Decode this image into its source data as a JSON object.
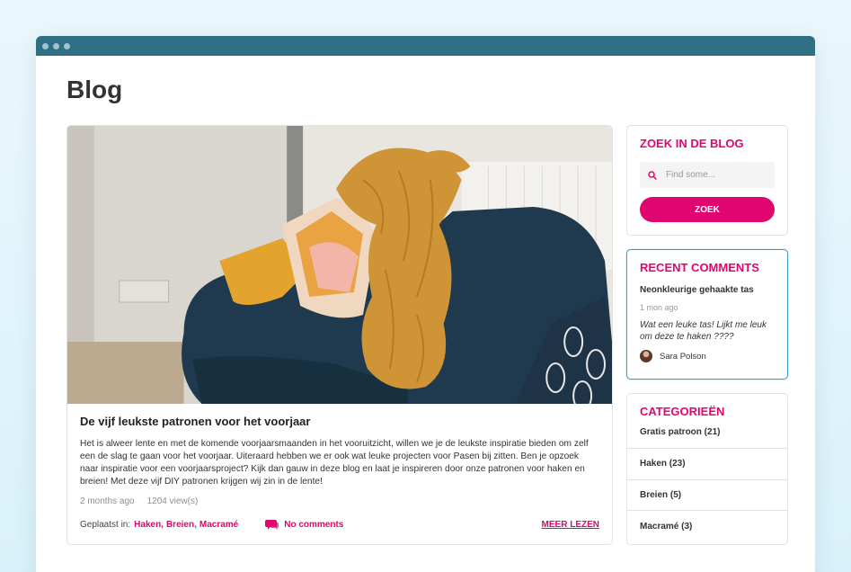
{
  "page": {
    "title": "Blog"
  },
  "post": {
    "title": "De vijf leukste patronen voor het voorjaar",
    "excerpt": "Het is alweer lente en met de komende voorjaarsmaanden in het vooruitzicht, willen we je de leukste inspiratie bieden om zelf een de slag te gaan voor het voorjaar. Uiteraard hebben we er ook wat leuke projecten voor Pasen bij zitten. Ben je opzoek naar inspiratie voor een voorjaarsproject? Kijk dan gauw in deze blog en laat je inspireren door onze patronen voor haken en breien! Met deze vijf DIY patronen krijgen wij zin in de lente!",
    "time": "2 months ago",
    "views": "1204 view(s)",
    "posted_in_label": "Geplaatst in:",
    "categories": [
      "Haken",
      "Breien",
      "Macramé"
    ],
    "comments_label": "No comments",
    "read_more": "MEER LEZEN"
  },
  "search": {
    "title": "ZOEK IN DE BLOG",
    "placeholder": "Find some...",
    "button": "ZOEK"
  },
  "recent_comments": {
    "title": "RECENT COMMENTS",
    "post_title": "Neonkleurige gehaakte tas",
    "time": "1 mon ago",
    "text": "Wat een leuke tas! Lijkt me leuk om deze te haken ????",
    "author": "Sara Polson"
  },
  "categories_widget": {
    "title": "CATEGORIEËN",
    "items": [
      "Gratis patroon (21)",
      "Haken (23)",
      "Breien (5)",
      "Macramé (3)"
    ]
  },
  "colors": {
    "accent": "#e0056f",
    "titlebar": "#2e6f84",
    "highlight_border": "#3a9bd0"
  },
  "icons": [
    "search-icon",
    "comment-bubble-icon"
  ]
}
